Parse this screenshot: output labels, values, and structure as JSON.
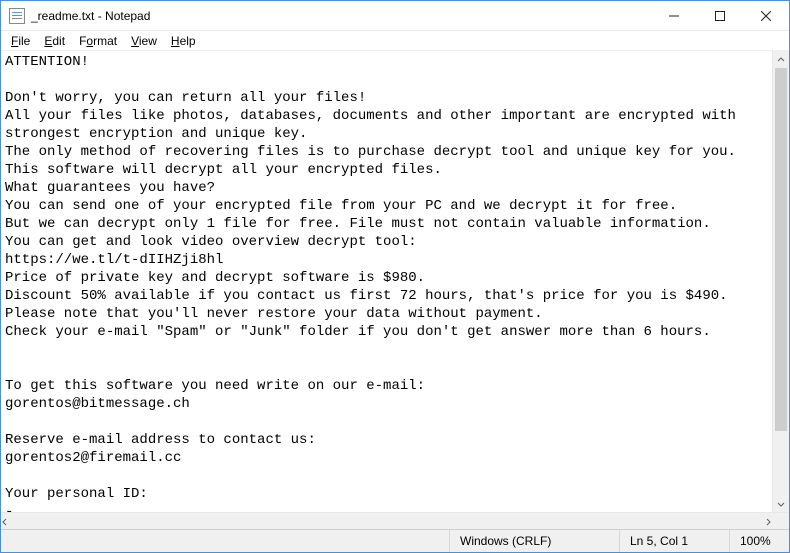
{
  "window": {
    "title": "_readme.txt - Notepad"
  },
  "menu": {
    "file": "File",
    "edit": "Edit",
    "format": "Format",
    "view": "View",
    "help": "Help"
  },
  "document": {
    "text": "ATTENTION!\n\nDon't worry, you can return all your files!\nAll your files like photos, databases, documents and other important are encrypted with strongest encryption and unique key.\nThe only method of recovering files is to purchase decrypt tool and unique key for you.\nThis software will decrypt all your encrypted files.\nWhat guarantees you have?\nYou can send one of your encrypted file from your PC and we decrypt it for free.\nBut we can decrypt only 1 file for free. File must not contain valuable information.\nYou can get and look video overview decrypt tool:\nhttps://we.tl/t-dIIHZji8hl\nPrice of private key and decrypt software is $980.\nDiscount 50% available if you contact us first 72 hours, that's price for you is $490.\nPlease note that you'll never restore your data without payment.\nCheck your e-mail \"Spam\" or \"Junk\" folder if you don't get answer more than 6 hours.\n\n\nTo get this software you need write on our e-mail:\ngorentos@bitmessage.ch\n\nReserve e-mail address to contact us:\ngorentos2@firemail.cc\n\nYour personal ID:\n-"
  },
  "status": {
    "encoding": "Windows (CRLF)",
    "position": "Ln 5, Col 1",
    "zoom": "100%"
  }
}
